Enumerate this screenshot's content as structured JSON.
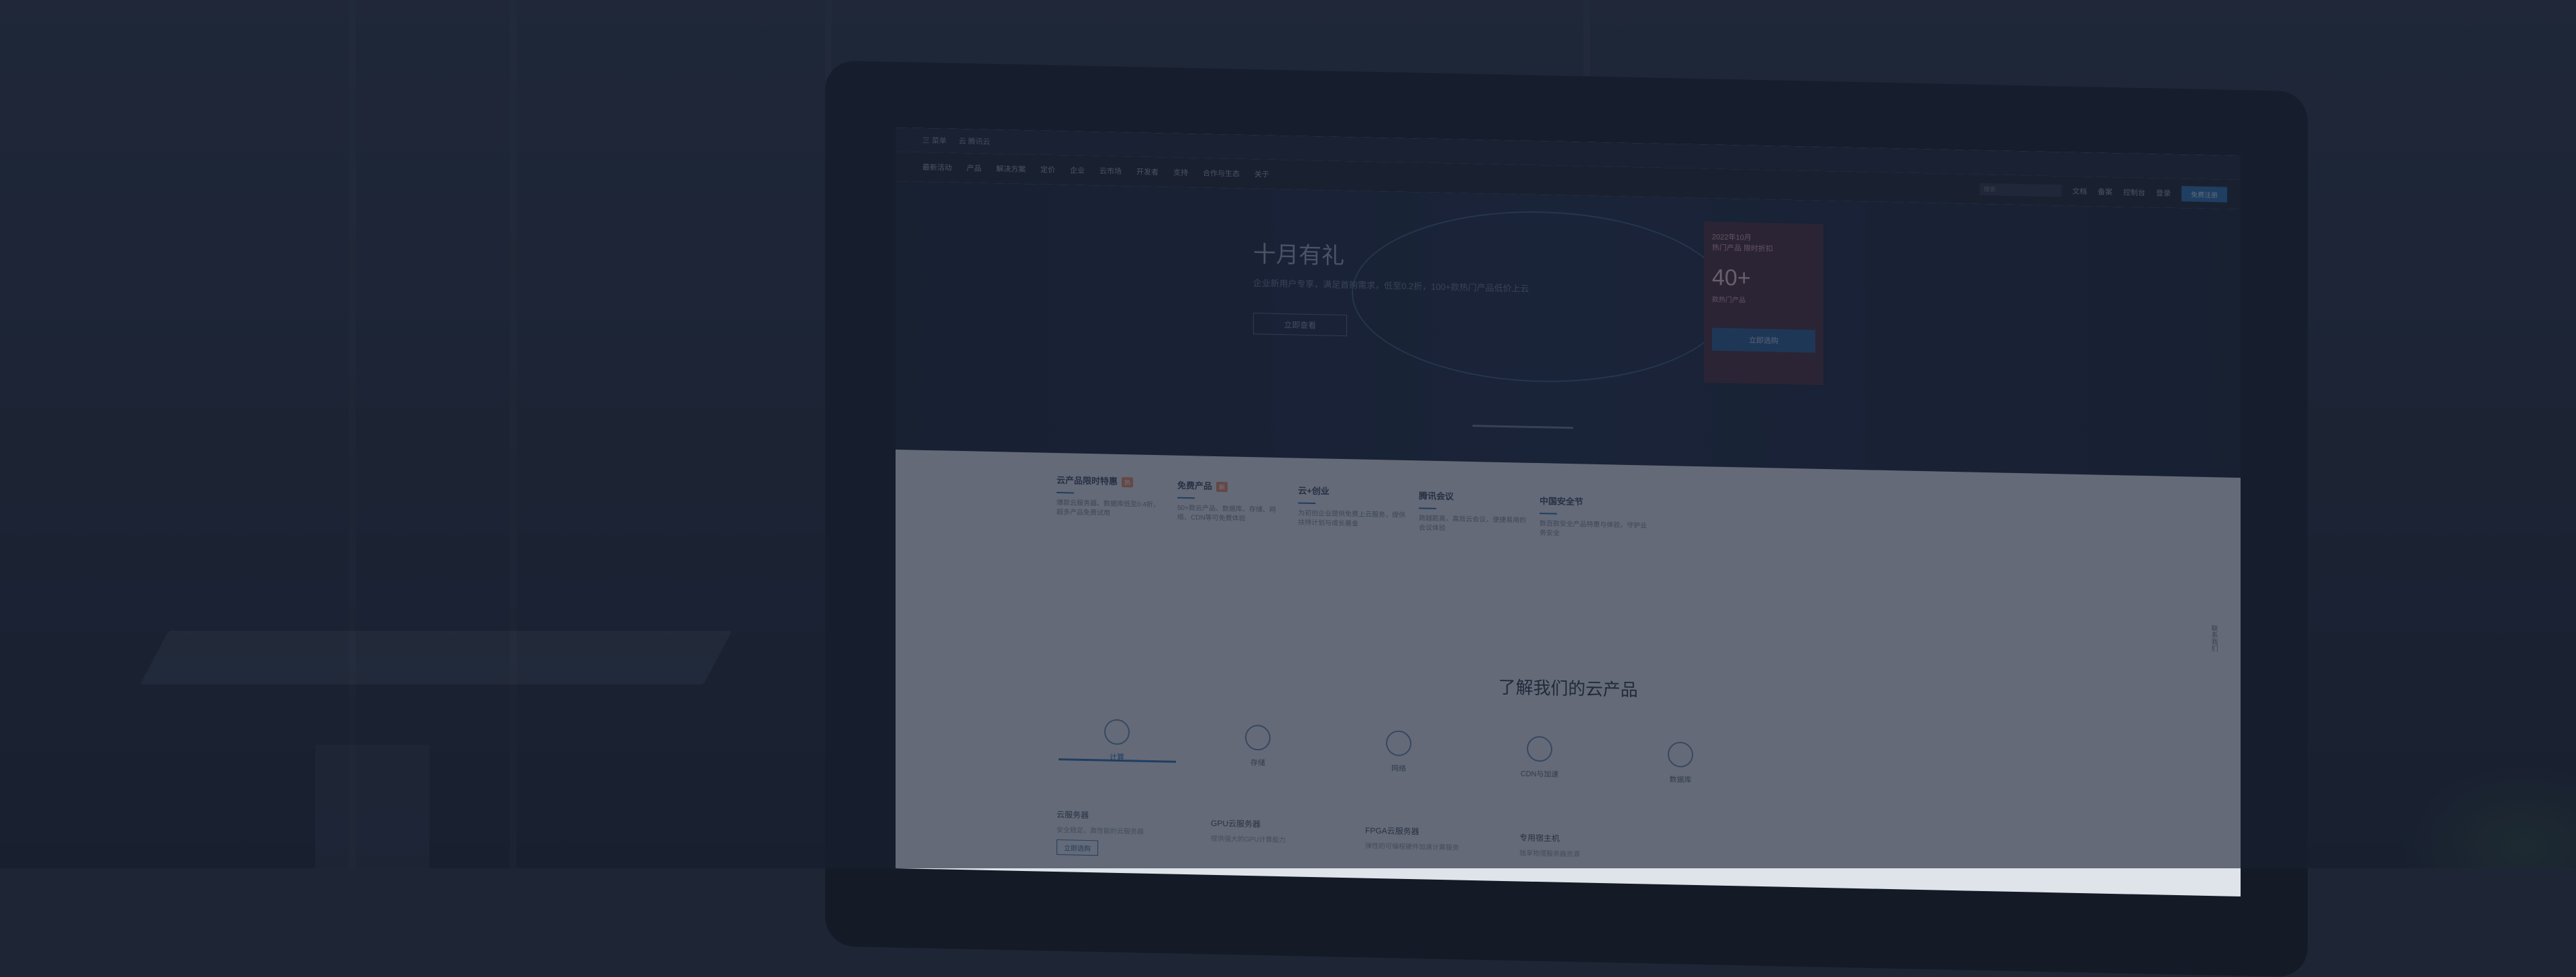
{
  "site": {
    "topbar": {
      "items": [
        "三 菜单",
        "云 腾讯云"
      ]
    },
    "nav": {
      "items": [
        "最新活动",
        "产品",
        "解决方案",
        "定价",
        "企业",
        "云市场",
        "开发者",
        "支持",
        "合作与生态",
        "关于"
      ],
      "search_placeholder": "搜索",
      "right_links": [
        "文档",
        "备案",
        "控制台"
      ],
      "login": "登录",
      "register": "免费注册"
    },
    "hero": {
      "title": "十月有礼",
      "subtitle": "企业新用户专享，满足首购需求，低至0.2折，100+款热门产品低价上云",
      "button": "立即查看",
      "card": {
        "line1": "2022年10月",
        "line2": "热门产品 限时折扣",
        "big_number": "40+",
        "line3": "款热门产品",
        "button": "立即选购"
      }
    },
    "promos": [
      {
        "title": "云产品限时特惠",
        "tag": "热",
        "desc": "爆款云服务器、数据库低至0.4折，超多产品免费试用"
      },
      {
        "title": "免费产品",
        "tag": "新",
        "desc": "50+款云产品、数据库、存储、网络、CDN等可免费体验"
      },
      {
        "title": "云+创业",
        "tag": "",
        "desc": "为初创企业提供免费上云服务，提供扶持计划与成长基金"
      },
      {
        "title": "腾讯会议",
        "tag": "",
        "desc": "跨越距离，高效云会议，便捷易用的会议体验"
      },
      {
        "title": "中国安全节",
        "tag": "",
        "desc": "数百款安全产品特惠与体验，守护业务安全"
      }
    ],
    "section_title": "了解我们的云产品",
    "tabs": [
      "计算",
      "存储",
      "网络",
      "CDN与加速",
      "数据库"
    ],
    "active_tab": "计算",
    "products": [
      {
        "name": "云服务器",
        "desc": "安全稳定、高性能的云服务器",
        "button": "立即选购"
      },
      {
        "name": "GPU云服务器",
        "desc": "提供强大的GPU计算能力",
        "button": ""
      },
      {
        "name": "FPGA云服务器",
        "desc": "弹性的可编程硬件加速计算服务",
        "button": ""
      },
      {
        "name": "专用宿主机",
        "desc": "独享物理服务器资源",
        "button": ""
      }
    ],
    "side_float": "联系我们"
  }
}
